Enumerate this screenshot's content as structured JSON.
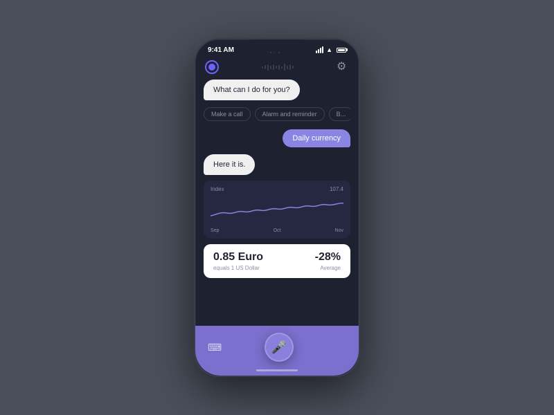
{
  "phone": {
    "status_bar": {
      "time": "9:41 AM",
      "battery_label": "battery"
    },
    "header": {
      "settings_icon": "⚙"
    },
    "chat": {
      "assistant_greeting": "What can I do for  you?",
      "quick_replies": [
        "Make a call",
        "Alarm and reminder",
        "B..."
      ],
      "user_message": "Daily currency",
      "assistant_response": "Here it is."
    },
    "chart": {
      "index_label": "Index",
      "index_value": "107.4",
      "labels": [
        "Sep",
        "Oct",
        "Nov"
      ]
    },
    "currency": {
      "value": "0.85 Euro",
      "sub_label": "equals 1 US Dollar",
      "percent": "-28%",
      "percent_label": "Average"
    },
    "bottom_bar": {
      "keyboard_icon": "⌨",
      "mic_icon": "🎤"
    }
  }
}
